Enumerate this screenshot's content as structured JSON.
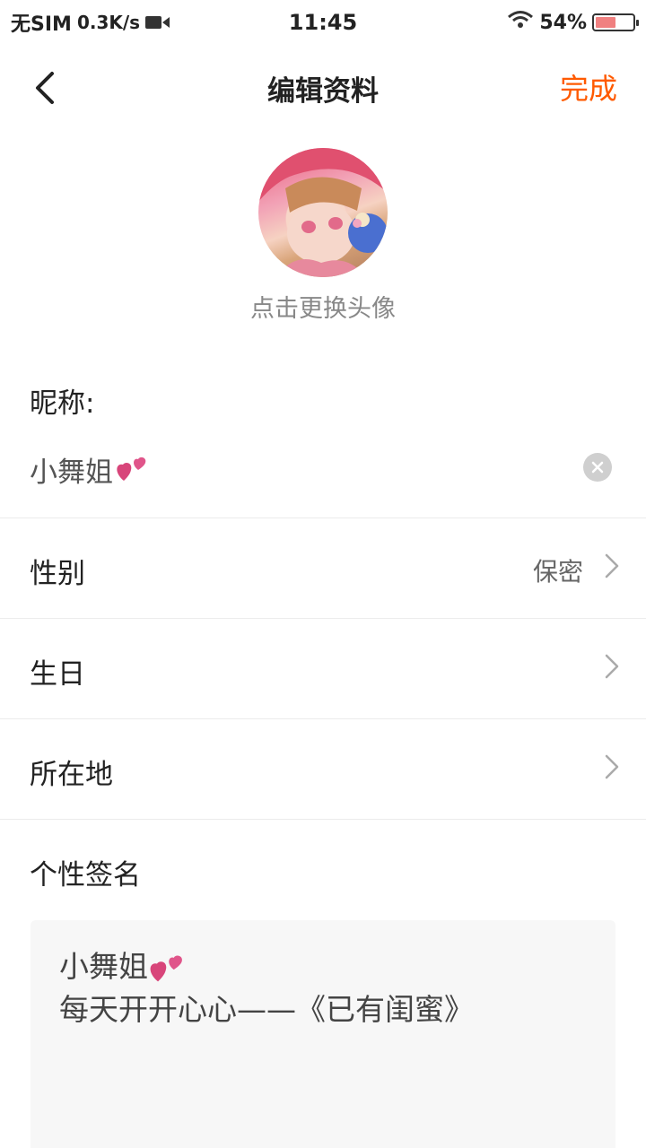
{
  "status_bar": {
    "carrier": "无SIM",
    "speed": "0.3K/s",
    "time": "11:45",
    "battery": "54%",
    "battery_level": 0.54,
    "camera_icon": "video-camera-icon",
    "wifi_icon": "wifi-icon"
  },
  "nav": {
    "title": "编辑资料",
    "done_label": "完成",
    "back_icon": "back-arrow-icon",
    "accent_color": "#ff5a00"
  },
  "avatar": {
    "hint": "点击更换头像"
  },
  "nickname": {
    "label": "昵称:",
    "value": "小舞姐",
    "heart_icon": "two-hearts-icon",
    "clear_icon": "clear-circle-icon"
  },
  "rows": [
    {
      "label": "性别",
      "value": "保密"
    },
    {
      "label": "生日",
      "value": ""
    },
    {
      "label": "所在地",
      "value": ""
    }
  ],
  "signature": {
    "label": "个性签名",
    "text_before": "小舞姐",
    "text_after": "每天开开心心——《已有闺蜜》"
  }
}
